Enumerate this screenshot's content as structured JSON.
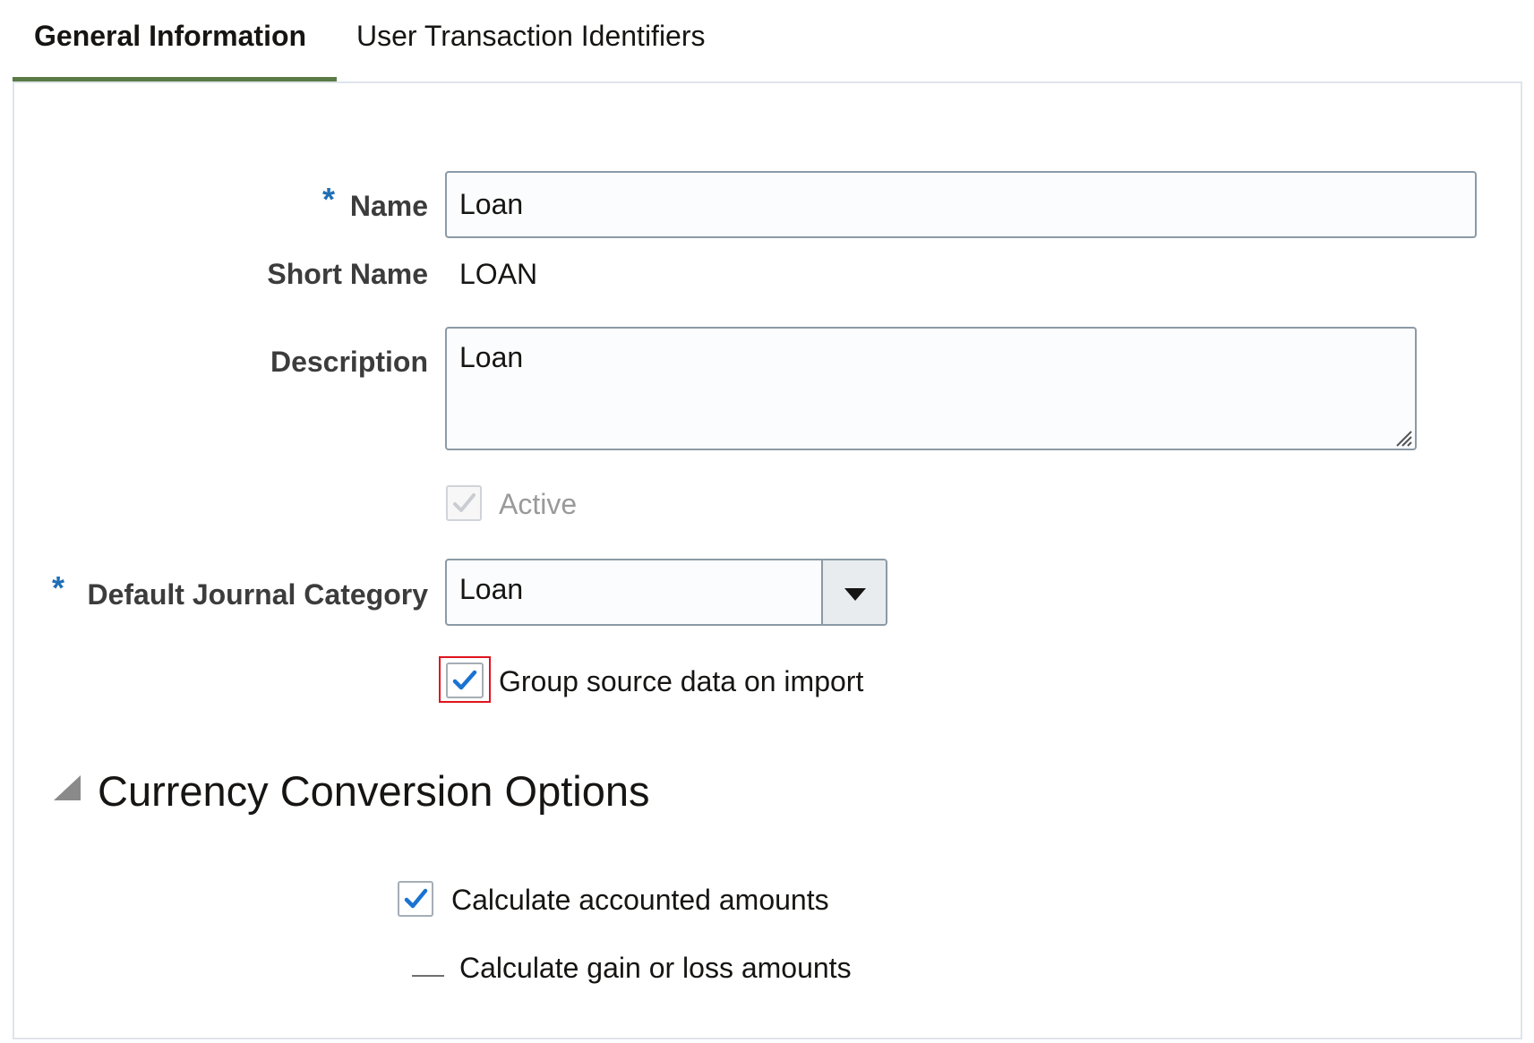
{
  "tabs": [
    {
      "label": "General Information",
      "selected": true
    },
    {
      "label": "User Transaction Identifiers",
      "selected": false
    }
  ],
  "form": {
    "name_label": "Name",
    "name_value": "Loan",
    "short_name_label": "Short Name",
    "short_name_value": "LOAN",
    "description_label": "Description",
    "description_value": "Loan",
    "active_label": "Active",
    "active_checked": true,
    "default_journal_category_label": "Default Journal Category",
    "default_journal_category_value": "Loan",
    "group_source_label": "Group source data on import",
    "group_source_checked": true,
    "required_marker": "*"
  },
  "currency_section": {
    "title": "Currency Conversion Options",
    "calc_accounted_label": "Calculate accounted amounts",
    "calc_accounted_checked": true,
    "calc_gain_loss_label": "Calculate gain or loss amounts",
    "calc_gain_loss_checked": false
  },
  "colors": {
    "tab_accent": "#5a7a46",
    "required_marker": "#1f6fb5",
    "checkmark": "#1a73d1",
    "focus_ring": "#e0141e"
  }
}
